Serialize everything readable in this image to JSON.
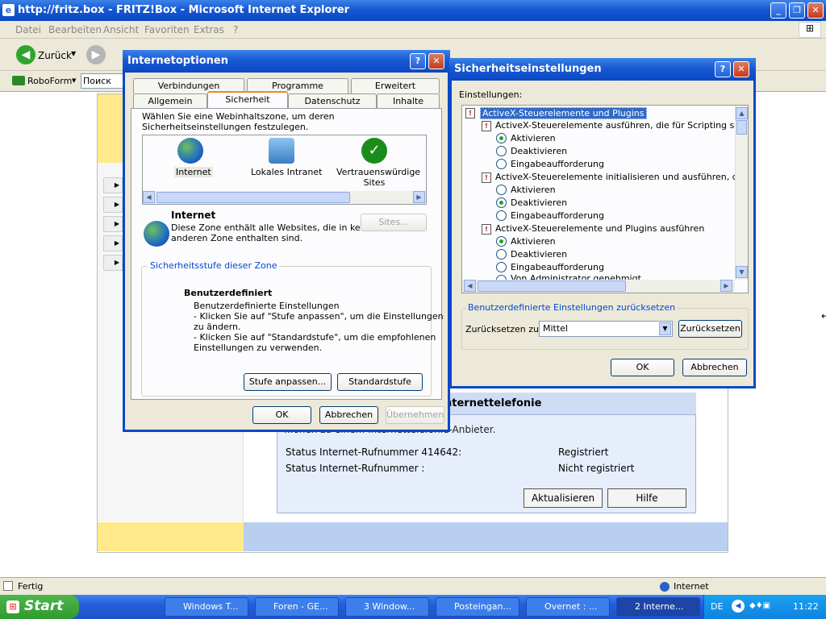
{
  "ie": {
    "title": "http://fritz.box - FRITZ!Box - Microsoft Internet Explorer",
    "menu": [
      "Datei",
      "Bearbeiten",
      "Ansicht",
      "Favoriten",
      "Extras",
      "?"
    ],
    "back_label": "Zurück",
    "links_roboform": "RoboForm",
    "links_search": "Поиск",
    "status_left": "Fertig",
    "status_zone": "Internet"
  },
  "fritz": {
    "section_title": "nternettelefonie",
    "description": "...onen zu einem Internettelefonie-Anbieter.",
    "rows": [
      {
        "label": "Status Internet-Rufnummer 414642:",
        "value": "Registriert"
      },
      {
        "label": "Status Internet-Rufnummer :",
        "value": "Nicht registriert"
      }
    ],
    "btn_refresh": "Aktualisieren",
    "btn_help": "Hilfe"
  },
  "inetopt": {
    "title": "Internetoptionen",
    "tabs_row1": [
      "Verbindungen",
      "Programme",
      "Erweitert"
    ],
    "tabs_row2": [
      "Allgemein",
      "Sicherheit",
      "Datenschutz",
      "Inhalte"
    ],
    "intro": "Wählen Sie eine Webinhaltszone, um deren Sicherheitseinstellungen festzulegen.",
    "zones": [
      "Internet",
      "Lokales Intranet",
      "Vertrauenswürdige Sites"
    ],
    "zone_name": "Internet",
    "zone_desc_1": "Diese Zone enthält alle Websites, die in keiner",
    "zone_desc_2": "anderen Zone enthalten sind.",
    "sites_btn": "Sites...",
    "level_group": "Sicherheitsstufe dieser Zone",
    "level_name": "Benutzerdefiniert",
    "level_lines": [
      "Benutzerdefinierte Einstellungen",
      "- Klicken Sie auf \"Stufe anpassen\", um die Einstellungen",
      "zu ändern.",
      "- Klicken Sie auf \"Standardstufe\", um die empfohlenen",
      "Einstellungen zu verwenden."
    ],
    "btn_custom": "Stufe anpassen...",
    "btn_default": "Standardstufe",
    "btn_ok": "OK",
    "btn_cancel": "Abbrechen",
    "btn_apply": "Übernehmen"
  },
  "secset": {
    "title": "Sicherheitseinstellungen",
    "settings_label": "Einstellungen:",
    "category": "ActiveX-Steuerelemente und Plugins",
    "items": [
      {
        "label": "ActiveX-Steuerelemente ausführen, die für Scripting sicher si"
      },
      {
        "label": "ActiveX-Steuerelemente initialisieren und ausführen, die nicht"
      },
      {
        "label": "ActiveX-Steuerelemente und Plugins ausführen"
      }
    ],
    "opt_enable": "Aktivieren",
    "opt_disable": "Deaktivieren",
    "opt_prompt": "Eingabeaufforderung",
    "cut_text": "Von Administrator genehmigt",
    "reset_group": "Benutzerdefinierte Einstellungen zurücksetzen",
    "reset_to_label": "Zurücksetzen zu:",
    "reset_value": "Mittel",
    "btn_reset": "Zurücksetzen",
    "btn_ok": "OK",
    "btn_cancel": "Abbrechen"
  },
  "taskbar": {
    "start": "Start",
    "tasks": [
      "Windows T...",
      "Foren - GE...",
      "3 Window...",
      "Posteingan...",
      "Overnet : ...",
      "2 Interne..."
    ],
    "lang": "DE",
    "clock": "11:22"
  }
}
